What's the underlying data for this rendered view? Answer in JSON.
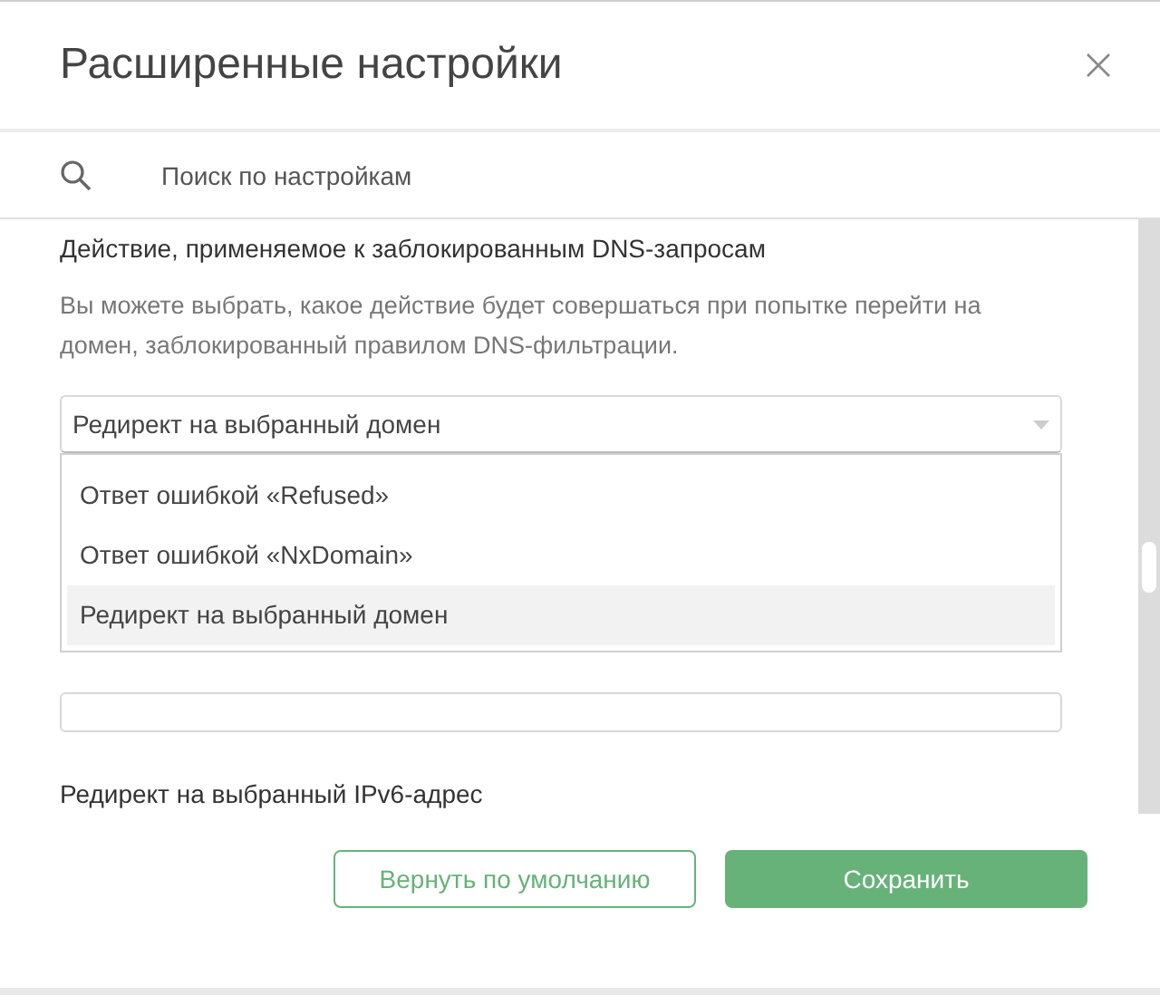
{
  "dialog": {
    "title": "Расширенные настройки"
  },
  "search": {
    "placeholder": "Поиск по настройкам"
  },
  "setting": {
    "title": "Действие, применяемое к заблокированным DNS-запросам",
    "description": "Вы можете выбрать, какое действие будет совершаться при попытке перейти на домен, заблокированный правилом DNS-фильтрации.",
    "select": {
      "value": "Редирект на выбранный домен",
      "expanded": true,
      "options": [
        {
          "label": "Ответ ошибкой «Refused»",
          "selected": false
        },
        {
          "label": "Ответ ошибкой «NxDomain»",
          "selected": false
        },
        {
          "label": "Редирект на выбранный домен",
          "selected": true
        }
      ]
    }
  },
  "next_setting": {
    "title": "Редирект на выбранный IPv6-адрес"
  },
  "buttons": {
    "reset": "Вернуть по умолчанию",
    "save": "Сохранить"
  }
}
